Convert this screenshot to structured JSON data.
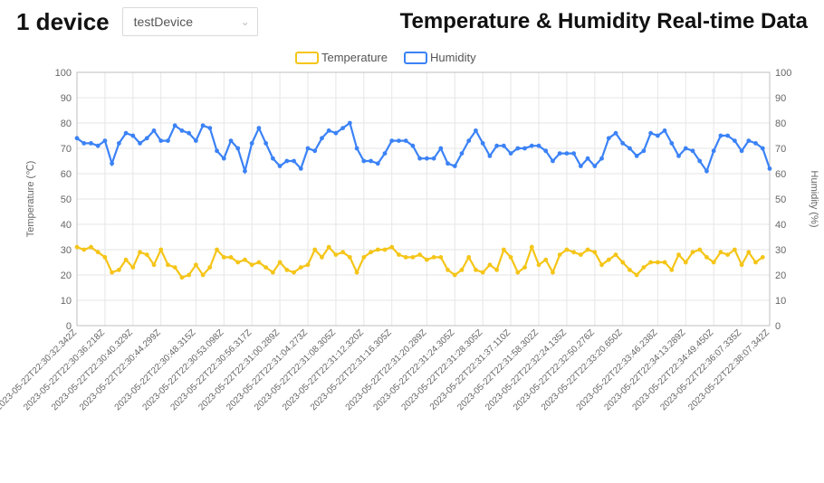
{
  "header": {
    "device_count_label": "1 device",
    "select_value": "testDevice"
  },
  "title": "Temperature & Humidity Real-time Data",
  "legend": {
    "temperature": "Temperature",
    "humidity": "Humidity"
  },
  "axes": {
    "left_label": "Temperature (℃)",
    "right_label": "Humidity (%)"
  },
  "colors": {
    "temperature": "#f5c518",
    "humidity": "#3b82f6",
    "grid": "#e6e6e6"
  },
  "chart_data": {
    "type": "line",
    "x": [
      "2023-05-22T22:30:32.342Z",
      "2023-05-22T22:30:36.218Z",
      "2023-05-22T22:30:40.329Z",
      "2023-05-22T22:30:44.299Z",
      "2023-05-22T22:30:48.315Z",
      "2023-05-22T22:30:53.098Z",
      "2023-05-22T22:30:56.317Z",
      "2023-05-22T22:31:00.289Z",
      "2023-05-22T22:31:04.273Z",
      "2023-05-22T22:31:08.305Z",
      "2023-05-22T22:31:12.320Z",
      "2023-05-22T22:31:16.305Z",
      "2023-05-22T22:31:20.289Z",
      "2023-05-22T22:31:24.305Z",
      "2023-05-22T22:31:28.305Z",
      "2023-05-22T22:31:37.110Z",
      "2023-05-22T22:31:58.302Z",
      "2023-05-22T22:32:24.135Z",
      "2023-05-22T22:32:50.276Z",
      "2023-05-22T22:33:20.650Z",
      "2023-05-22T22:33:46.238Z",
      "2023-05-22T22:34:13.289Z",
      "2023-05-22T22:34:49.450Z",
      "2023-05-22T22:36:07.335Z",
      "2023-05-22T22:38:07.342Z"
    ],
    "series": [
      {
        "name": "Temperature",
        "values": [
          31,
          30,
          31,
          29,
          27,
          21,
          22,
          26,
          23,
          29,
          28,
          24,
          30,
          24,
          23,
          19,
          20,
          24,
          20,
          23,
          30,
          27,
          27,
          25,
          26,
          24,
          25,
          23,
          21,
          25,
          22,
          21,
          23,
          24,
          30,
          27,
          31,
          28,
          29,
          27,
          21,
          27,
          29,
          30,
          30,
          31,
          28,
          27,
          27,
          28,
          26,
          27,
          27,
          22,
          20,
          22,
          27,
          22,
          21,
          24,
          22,
          30,
          27,
          21,
          23,
          31,
          24,
          26,
          21,
          28,
          30,
          29,
          28,
          30,
          29,
          24,
          26,
          28,
          25,
          22,
          20,
          23,
          25,
          25,
          25,
          22,
          28,
          25,
          29,
          30,
          27,
          25,
          29,
          28,
          30,
          24,
          29,
          25,
          27
        ]
      },
      {
        "name": "Humidity",
        "values": [
          74,
          72,
          72,
          71,
          73,
          64,
          72,
          76,
          75,
          72,
          74,
          77,
          73,
          73,
          79,
          77,
          76,
          73,
          79,
          78,
          69,
          66,
          73,
          70,
          61,
          72,
          78,
          72,
          66,
          63,
          65,
          65,
          62,
          70,
          69,
          74,
          77,
          76,
          78,
          80,
          70,
          65,
          65,
          64,
          68,
          73,
          73,
          73,
          71,
          66,
          66,
          66,
          70,
          64,
          63,
          68,
          73,
          77,
          72,
          67,
          71,
          71,
          68,
          70,
          70,
          71,
          71,
          69,
          65,
          68,
          68,
          68,
          63,
          66,
          63,
          66,
          74,
          76,
          72,
          70,
          67,
          69,
          76,
          75,
          77,
          72,
          67,
          70,
          69,
          65,
          61,
          69,
          75,
          75,
          73,
          69,
          73,
          72,
          70,
          62
        ]
      }
    ],
    "ylim": [
      0,
      100
    ],
    "yticks": [
      0,
      10,
      20,
      30,
      40,
      50,
      60,
      70,
      80,
      90,
      100
    ],
    "ylabel": "Temperature (℃)",
    "y2label": "Humidity (%)",
    "grid": true,
    "legend_position": "top"
  }
}
